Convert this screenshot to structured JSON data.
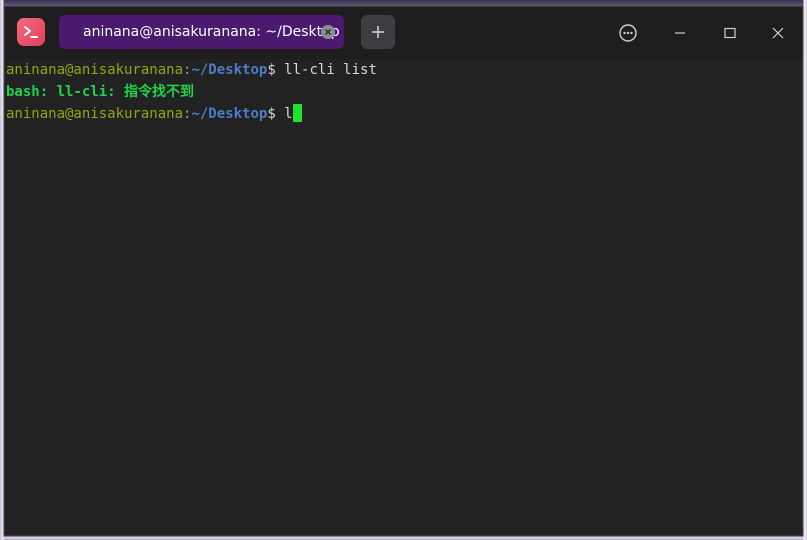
{
  "window": {
    "tab_title": "aninana@anisakuranana: ~/Desktop",
    "new_tab_symbol": "+",
    "app_icon": "terminal-app-icon",
    "controls": [
      "more-options-icon",
      "minimize-icon",
      "maximize-icon",
      "close-icon"
    ]
  },
  "terminal": {
    "lines": [
      {
        "type": "prompt",
        "user": "aninana@anisakuranana",
        "colon": ":",
        "path": "~/Desktop",
        "dollar": "$",
        "command": " ll-cli list"
      },
      {
        "type": "error",
        "text": "bash: ll-cli: 指令找不到"
      },
      {
        "type": "prompt",
        "user": "aninana@anisakuranana",
        "colon": ":",
        "path": "~/Desktop",
        "dollar": "$",
        "command": " l"
      }
    ]
  },
  "colors": {
    "tab_active": "#4b1a6e",
    "prompt_user": "#8ea812",
    "prompt_path": "#4a7ec6",
    "error_text": "#1fd34a",
    "cursor": "#1fe32e",
    "background": "#222222"
  }
}
